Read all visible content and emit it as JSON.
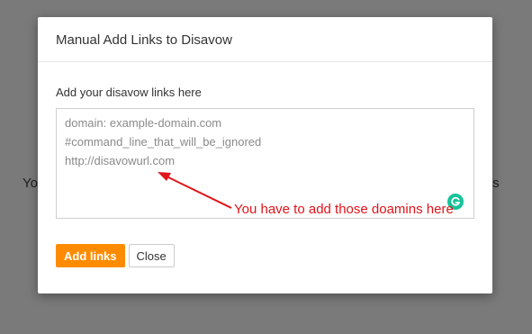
{
  "backdrop": {
    "left_fragment": "Yo",
    "right_fragment": "ts"
  },
  "modal": {
    "title": "Manual Add Links to Disavow",
    "label": "Add your disavow links here",
    "textarea_lines": [
      "domain: example-domain.com",
      "#command_line_that_will_be_ignored",
      "http://disavowurl.com"
    ],
    "add_button": "Add links",
    "close_button": "Close"
  },
  "annotation": {
    "text": "You have to add those doamins here",
    "color": "#e0141a"
  },
  "colors": {
    "primary_button": "#ff8c00",
    "grammarly": "#15c39a",
    "overlay": "#7a7a7a"
  },
  "icons": {
    "grammarly": "grammarly-icon",
    "annotation_arrow": "red-arrow-icon"
  }
}
